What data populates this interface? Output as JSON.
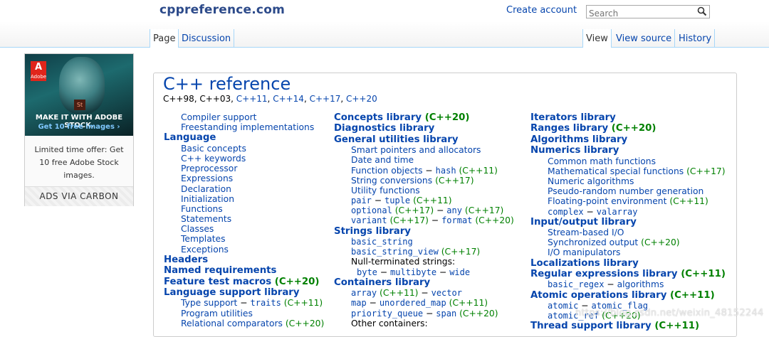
{
  "header": {
    "logo": "cppreference.com",
    "create_account": "Create account",
    "search_placeholder": "Search",
    "tabs_left": [
      "Page",
      "Discussion"
    ],
    "tabs_right": [
      "View",
      "View source",
      "History"
    ]
  },
  "ad": {
    "brand": "Adobe",
    "headline": "MAKE IT WITH ADOBE STOCK.",
    "subheadline": "Get 10 free images ›",
    "app_badge": "St",
    "offer_text": "Limited time offer: Get 10 free Adobe Stock images.",
    "via": "ADS VIA CARBON"
  },
  "main": {
    "title": "C++ reference",
    "standards": [
      "C++98, C++03, ",
      "C++11",
      ", ",
      "C++14",
      ", ",
      "C++17",
      ", ",
      "C++20"
    ]
  },
  "watermark": "https://blog.csdn.net/weixin_48152244",
  "col1": [
    {
      "type": "ind",
      "text": "Compiler support"
    },
    {
      "type": "ind",
      "text": "Freestanding implementations"
    },
    {
      "type": "h",
      "text": "Language"
    },
    {
      "type": "ind",
      "text": "Basic concepts"
    },
    {
      "type": "ind",
      "text": "C++ keywords"
    },
    {
      "type": "ind",
      "text": "Preprocessor"
    },
    {
      "type": "ind",
      "text": "Expressions"
    },
    {
      "type": "ind",
      "text": "Declaration"
    },
    {
      "type": "ind",
      "text": "Initialization"
    },
    {
      "type": "ind",
      "text": "Functions"
    },
    {
      "type": "ind",
      "text": "Statements"
    },
    {
      "type": "ind",
      "text": "Classes"
    },
    {
      "type": "ind",
      "text": "Templates"
    },
    {
      "type": "ind",
      "text": "Exceptions"
    },
    {
      "type": "h",
      "text": "Headers"
    },
    {
      "type": "h",
      "text": "Named requirements"
    },
    {
      "type": "h",
      "text": "Feature test macros",
      "ver": "(C++20)"
    },
    {
      "type": "h",
      "text": "Language support library"
    },
    {
      "type": "ind",
      "text": "Type support",
      "sep": "traits",
      "ver": "(C++11)"
    },
    {
      "type": "ind",
      "text": "Program utilities"
    },
    {
      "type": "ind",
      "text": "Relational comparators",
      "ver": "(C++20)"
    }
  ],
  "col2": [
    {
      "type": "h",
      "text": "Concepts library",
      "ver": "(C++20)"
    },
    {
      "type": "h",
      "text": "Diagnostics library"
    },
    {
      "type": "h",
      "text": "General utilities library"
    },
    {
      "type": "ind",
      "text": "Smart pointers and allocators"
    },
    {
      "type": "ind",
      "text": "Date and time"
    },
    {
      "type": "ind",
      "text": "Function objects",
      "sep": "hash",
      "ver": "(C++11)"
    },
    {
      "type": "ind",
      "text": "String conversions",
      "ver": "(C++17)"
    },
    {
      "type": "ind",
      "text": "Utility functions"
    },
    {
      "type": "indt",
      "text": "pair",
      "sep": "tuple",
      "ver": "(C++11)"
    },
    {
      "type": "indt",
      "text": "optional",
      "ver1": "(C++17)",
      "sep": "any",
      "ver": "(C++17)"
    },
    {
      "type": "indt",
      "text": "variant",
      "ver1": "(C++17)",
      "sep": "format",
      "ver": "(C++20)"
    },
    {
      "type": "h",
      "text": "Strings library"
    },
    {
      "type": "indt",
      "text": "basic_string"
    },
    {
      "type": "indt",
      "text": "basic_string_view",
      "ver": "(C++17)"
    },
    {
      "type": "indk",
      "text": "Null-terminated strings:"
    },
    {
      "type": "ind2t",
      "text": "byte",
      "sep": "multibyte",
      "sep2": "wide"
    },
    {
      "type": "h",
      "text": "Containers library"
    },
    {
      "type": "indt",
      "text": "array",
      "ver1": "(C++11)",
      "sep": "vector"
    },
    {
      "type": "indt",
      "text": "map",
      "sep": "unordered_map",
      "ver": "(C++11)"
    },
    {
      "type": "indt",
      "text": "priority_queue",
      "sep": "span",
      "ver": "(C++20)"
    },
    {
      "type": "indk",
      "text": "Other containers:"
    }
  ],
  "col3": [
    {
      "type": "h",
      "text": "Iterators library"
    },
    {
      "type": "h",
      "text": "Ranges library",
      "ver": "(C++20)"
    },
    {
      "type": "h",
      "text": "Algorithms library"
    },
    {
      "type": "h",
      "text": "Numerics library"
    },
    {
      "type": "ind",
      "text": "Common math functions"
    },
    {
      "type": "ind",
      "text": "Mathematical special functions",
      "ver": "(C++17)"
    },
    {
      "type": "ind",
      "text": "Numeric algorithms"
    },
    {
      "type": "ind",
      "text": "Pseudo-random number generation"
    },
    {
      "type": "ind",
      "text": "Floating-point environment",
      "ver": "(C++11)"
    },
    {
      "type": "indt",
      "text": "complex",
      "sep": "valarray"
    },
    {
      "type": "h",
      "text": "Input/output library"
    },
    {
      "type": "ind",
      "text": "Stream-based I/O"
    },
    {
      "type": "ind",
      "text": "Synchronized output",
      "ver": "(C++20)"
    },
    {
      "type": "ind",
      "text": "I/O manipulators"
    },
    {
      "type": "h",
      "text": "Localizations library"
    },
    {
      "type": "h",
      "text": "Regular expressions library",
      "ver": "(C++11)"
    },
    {
      "type": "indt",
      "text": "basic_regex",
      "sep": "algorithms",
      "septext": true
    },
    {
      "type": "h",
      "text": "Atomic operations library",
      "ver": "(C++11)"
    },
    {
      "type": "indt",
      "text": "atomic",
      "sep": "atomic_flag"
    },
    {
      "type": "indt",
      "text": "atomic_ref",
      "ver": "(C++20)"
    },
    {
      "type": "h",
      "text": "Thread support library",
      "ver": "(C++11)"
    }
  ]
}
